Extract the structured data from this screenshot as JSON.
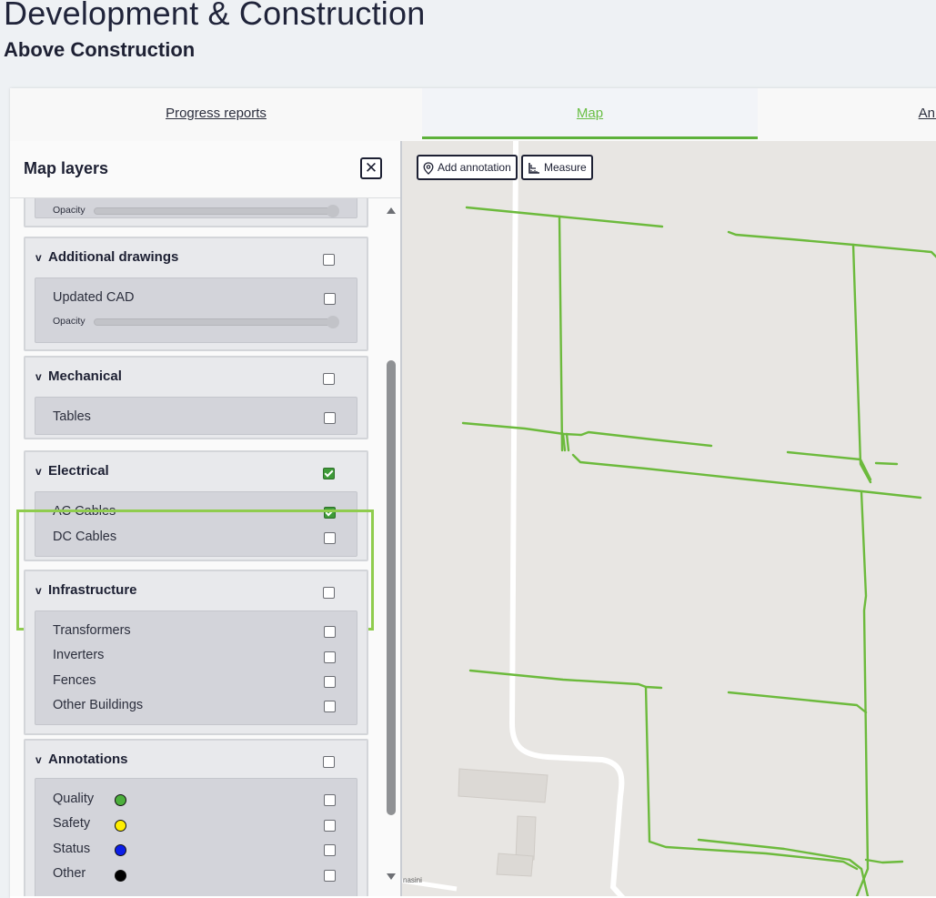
{
  "header": {
    "title": "Development & Construction",
    "subtitle": "Above Construction"
  },
  "tabs": [
    {
      "label": "Progress reports",
      "active": false
    },
    {
      "label": "Map",
      "active": true
    },
    {
      "label": "Ann",
      "active": false
    }
  ],
  "panel": {
    "title": "Map layers",
    "close_icon": "close-icon",
    "opacity_label": "Opacity",
    "groups": [
      {
        "name": "Additional drawings",
        "checked": false,
        "items": [
          {
            "label": "Updated CAD",
            "checked": false
          }
        ]
      },
      {
        "name": "Mechanical",
        "checked": false,
        "items": [
          {
            "label": "Tables",
            "checked": false
          }
        ]
      },
      {
        "name": "Electrical",
        "checked": true,
        "highlighted": true,
        "items": [
          {
            "label": "AC Cables",
            "checked": true
          },
          {
            "label": "DC Cables",
            "checked": false
          }
        ]
      },
      {
        "name": "Infrastructure",
        "checked": false,
        "items": [
          {
            "label": "Transformers",
            "checked": false
          },
          {
            "label": "Inverters",
            "checked": false
          },
          {
            "label": "Fences",
            "checked": false
          },
          {
            "label": "Other Buildings",
            "checked": false
          }
        ]
      },
      {
        "name": "Annotations",
        "checked": false,
        "items": [
          {
            "label": "Quality",
            "checked": false,
            "color": "#4caf3c"
          },
          {
            "label": "Safety",
            "checked": false,
            "color": "#ffee00"
          },
          {
            "label": "Status",
            "checked": false,
            "color": "#0b1ee8"
          },
          {
            "label": "Other",
            "checked": false,
            "color": "#000000"
          }
        ]
      }
    ]
  },
  "map": {
    "add_annotation_label": "Add annotation",
    "measure_label": "Measure",
    "road_label": "nasini",
    "cable_color": "#6cba3c"
  }
}
